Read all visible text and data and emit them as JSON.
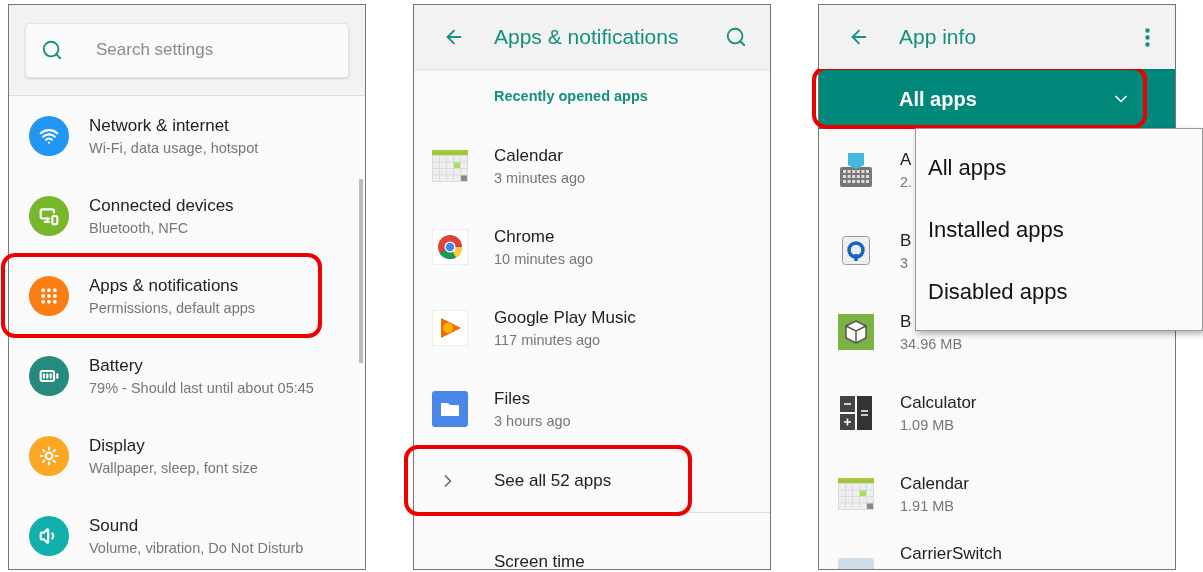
{
  "settings_screen": {
    "search": {
      "placeholder": "Search settings"
    },
    "items": [
      {
        "title": "Network & internet",
        "subtitle": "Wi-Fi, data usage, hotspot",
        "color": "#2196f3",
        "highlighted": false
      },
      {
        "title": "Connected devices",
        "subtitle": "Bluetooth, NFC",
        "color": "#76b82a",
        "highlighted": false
      },
      {
        "title": "Apps & notifications",
        "subtitle": "Permissions, default apps",
        "color": "#fb7e14",
        "highlighted": true
      },
      {
        "title": "Battery",
        "subtitle": "79% - Should last until about 05:45",
        "color": "#268a7c",
        "highlighted": false
      },
      {
        "title": "Display",
        "subtitle": "Wallpaper, sleep, font size",
        "color": "#fba625",
        "highlighted": false
      },
      {
        "title": "Sound",
        "subtitle": "Volume, vibration, Do Not Disturb",
        "color": "#12b0aa",
        "highlighted": false
      }
    ]
  },
  "apps_screen": {
    "title": "Apps & notifications",
    "section_header": "Recently opened apps",
    "recent_apps": [
      {
        "name": "Calendar",
        "time": "3 minutes ago"
      },
      {
        "name": "Chrome",
        "time": "10 minutes ago"
      },
      {
        "name": "Google Play Music",
        "time": "117 minutes ago"
      },
      {
        "name": "Files",
        "time": "3 hours ago"
      }
    ],
    "see_all": {
      "label": "See all 52 apps",
      "highlighted": true
    },
    "next_item": "Screen time"
  },
  "app_info_screen": {
    "title": "App info",
    "filter": {
      "label": "All apps",
      "highlighted": true,
      "expanded": true
    },
    "menu": [
      {
        "label": "All apps"
      },
      {
        "label": "Installed apps"
      },
      {
        "label": "Disabled apps"
      }
    ],
    "apps": [
      {
        "name": "A",
        "size": "2."
      },
      {
        "name": "B",
        "size": "3"
      },
      {
        "name": "B",
        "size": "34.96 MB"
      },
      {
        "name": "Calculator",
        "size": "1.09 MB"
      },
      {
        "name": "Calendar",
        "size": "1.91 MB"
      },
      {
        "name": "CarrierSwitch"
      }
    ]
  }
}
